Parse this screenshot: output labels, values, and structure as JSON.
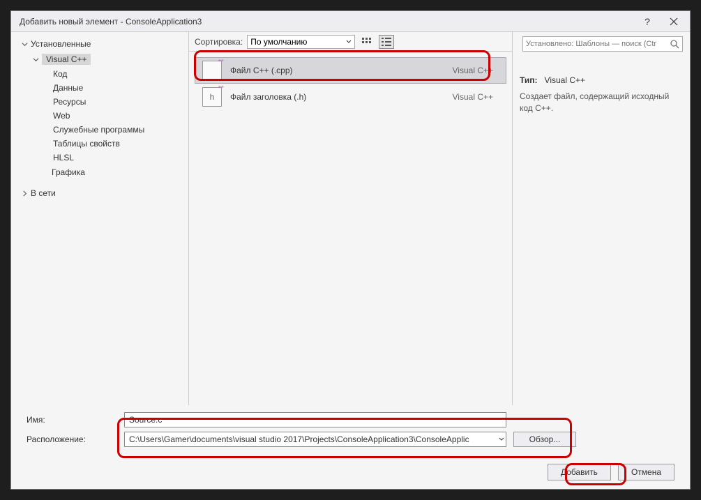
{
  "title": "Добавить новый элемент - ConsoleApplication3",
  "tree": {
    "root": "Установленные",
    "vcpp": "Visual C++",
    "children": [
      "Код",
      "Данные",
      "Ресурсы",
      "Web",
      "Служебные программы",
      "Таблицы свойств",
      "HLSL"
    ],
    "graphics": "Графика",
    "net": "В сети"
  },
  "toolbar": {
    "sort_label": "Сортировка:",
    "sort_value": "По умолчанию",
    "search_placeholder": "Установлено: Шаблоны — поиск (Ctr"
  },
  "templates": [
    {
      "name": "Файл C++ (.cpp)",
      "cat": "Visual C++",
      "icon": "cpp",
      "selected": true
    },
    {
      "name": "Файл заголовка (.h)",
      "cat": "Visual C++",
      "icon": "h",
      "selected": false
    }
  ],
  "details": {
    "type_label": "Тип:",
    "type_value": "Visual C++",
    "desc": "Создает файл, содержащий исходный код C++."
  },
  "form": {
    "name_label": "Имя:",
    "name_value": "Source.c",
    "loc_label": "Расположение:",
    "loc_value": "C:\\Users\\Gamer\\documents\\visual studio 2017\\Projects\\ConsoleApplication3\\ConsoleApplic",
    "browse": "Обзор..."
  },
  "buttons": {
    "add": "Добавить",
    "cancel": "Отмена"
  }
}
